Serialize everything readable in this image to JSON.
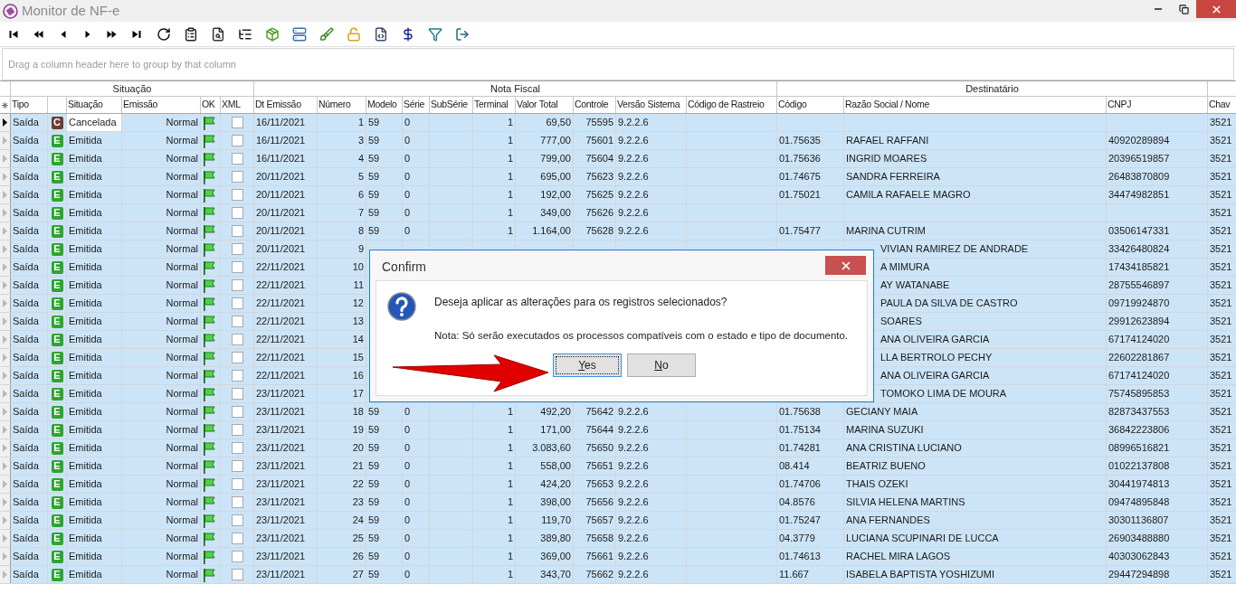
{
  "window": {
    "title": "Monitor de NF-e"
  },
  "group_panel": {
    "placeholder": "Drag a column header here to group by that column"
  },
  "column_groups": [
    {
      "label": "Situação"
    },
    {
      "label": "Nota Fiscal"
    },
    {
      "label": "Destinatário"
    }
  ],
  "columns": [
    "Tipo",
    "Situação",
    "Emissão",
    "OK",
    "XML",
    "Dt Emissão",
    "Número",
    "Modelo",
    "Série",
    "SubSérie",
    "Terminal",
    "Valor Total",
    "Controle",
    "Versão Sistema",
    "Código de Rastreio",
    "Código",
    "Razão Social / Nome",
    "CNPJ",
    "Chav"
  ],
  "rows": [
    {
      "selected": true,
      "current": true,
      "tipo": "Saída",
      "status_icon": "C",
      "color": "#6e3b33",
      "situacao": "Cancelada",
      "emissao": "Normal",
      "xml": false,
      "dt_emissao": "16/11/2021",
      "numero": "1",
      "modelo": "59",
      "serie": "0",
      "terminal": "1",
      "valor_total": "69,50",
      "controle": "75595",
      "versao": "9.2.2.6",
      "chave": "3521"
    },
    {
      "selected": true,
      "current": false,
      "tipo": "Saída",
      "status_icon": "E",
      "color": "#2ea52e",
      "situacao": "Emitida",
      "emissao": "Normal",
      "xml": false,
      "dt_emissao": "16/11/2021",
      "numero": "3",
      "modelo": "59",
      "serie": "0",
      "terminal": "1",
      "valor_total": "777,00",
      "controle": "75601",
      "versao": "9.2.2.6",
      "codigo": "01.75635",
      "razao_social": "RAFAEL RAFFANI",
      "cnpj": "40920289894",
      "chave": "3521"
    },
    {
      "selected": true,
      "current": false,
      "tipo": "Saída",
      "status_icon": "E",
      "color": "#2ea52e",
      "situacao": "Emitida",
      "emissao": "Normal",
      "xml": false,
      "dt_emissao": "16/11/2021",
      "numero": "4",
      "modelo": "59",
      "serie": "0",
      "terminal": "1",
      "valor_total": "799,00",
      "controle": "75604",
      "versao": "9.2.2.6",
      "codigo": "01.75636",
      "razao_social": "INGRID MOARES",
      "cnpj": "20396519857",
      "chave": "3521"
    },
    {
      "selected": true,
      "current": false,
      "tipo": "Saída",
      "status_icon": "E",
      "color": "#2ea52e",
      "situacao": "Emitida",
      "emissao": "Normal",
      "xml": false,
      "dt_emissao": "20/11/2021",
      "numero": "5",
      "modelo": "59",
      "serie": "0",
      "terminal": "1",
      "valor_total": "695,00",
      "controle": "75623",
      "versao": "9.2.2.6",
      "codigo": "01.74675",
      "razao_social": "SANDRA FERREIRA",
      "cnpj": "26483870809",
      "chave": "3521"
    },
    {
      "selected": true,
      "current": false,
      "tipo": "Saída",
      "status_icon": "E",
      "color": "#2ea52e",
      "situacao": "Emitida",
      "emissao": "Normal",
      "xml": false,
      "dt_emissao": "20/11/2021",
      "numero": "6",
      "modelo": "59",
      "serie": "0",
      "terminal": "1",
      "valor_total": "192,00",
      "controle": "75625",
      "versao": "9.2.2.6",
      "codigo": "01.75021",
      "razao_social": "CAMILA RAFAELE MAGRO",
      "cnpj": "34474982851",
      "chave": "3521"
    },
    {
      "selected": true,
      "current": false,
      "tipo": "Saída",
      "status_icon": "E",
      "color": "#2ea52e",
      "situacao": "Emitida",
      "emissao": "Normal",
      "xml": false,
      "dt_emissao": "20/11/2021",
      "numero": "7",
      "modelo": "59",
      "serie": "0",
      "terminal": "1",
      "valor_total": "349,00",
      "controle": "75626",
      "versao": "9.2.2.6",
      "chave": "3521"
    },
    {
      "selected": true,
      "current": false,
      "tipo": "Saída",
      "status_icon": "E",
      "color": "#2ea52e",
      "situacao": "Emitida",
      "emissao": "Normal",
      "xml": false,
      "dt_emissao": "20/11/2021",
      "numero": "8",
      "modelo": "59",
      "serie": "0",
      "terminal": "1",
      "valor_total": "1.164,00",
      "controle": "75628",
      "versao": "9.2.2.6",
      "codigo": "01.75477",
      "razao_social": "MARINA CUTRIM",
      "cnpj": "03506147331",
      "chave": "3521"
    },
    {
      "selected": true,
      "current": false,
      "tipo": "Saída",
      "status_icon": "E",
      "color": "#2ea52e",
      "situacao": "Emitida",
      "emissao": "Normal",
      "xml": false,
      "dt_emissao": "20/11/2021",
      "numero": "9",
      "razao_social": "VIVIAN RAMIREZ DE ANDRADE",
      "cnpj": "33426480824",
      "chave": "3521"
    },
    {
      "selected": true,
      "current": false,
      "tipo": "Saída",
      "status_icon": "E",
      "color": "#2ea52e",
      "situacao": "Emitida",
      "emissao": "Normal",
      "xml": false,
      "dt_emissao": "22/11/2021",
      "numero": "10",
      "razao_social": "A MIMURA",
      "cnpj": "17434185821",
      "chave": "3521"
    },
    {
      "selected": true,
      "current": false,
      "tipo": "Saída",
      "status_icon": "E",
      "color": "#2ea52e",
      "situacao": "Emitida",
      "emissao": "Normal",
      "xml": false,
      "dt_emissao": "22/11/2021",
      "numero": "11",
      "razao_social": "AY WATANABE",
      "cnpj": "28755546897",
      "chave": "3521"
    },
    {
      "selected": true,
      "current": false,
      "tipo": "Saída",
      "status_icon": "E",
      "color": "#2ea52e",
      "situacao": "Emitida",
      "emissao": "Normal",
      "xml": false,
      "dt_emissao": "22/11/2021",
      "numero": "12",
      "razao_social": "PAULA DA SILVA DE CASTRO",
      "cnpj": "09719924870",
      "chave": "3521"
    },
    {
      "selected": true,
      "current": false,
      "tipo": "Saída",
      "status_icon": "E",
      "color": "#2ea52e",
      "situacao": "Emitida",
      "emissao": "Normal",
      "xml": false,
      "dt_emissao": "22/11/2021",
      "numero": "13",
      "razao_social": "SOARES",
      "cnpj": "29912623894",
      "chave": "3521"
    },
    {
      "selected": true,
      "current": false,
      "tipo": "Saída",
      "status_icon": "E",
      "color": "#2ea52e",
      "situacao": "Emitida",
      "emissao": "Normal",
      "xml": false,
      "dt_emissao": "22/11/2021",
      "numero": "14",
      "razao_social": "ANA OLIVEIRA GARCIA",
      "cnpj": "67174124020",
      "chave": "3521"
    },
    {
      "selected": true,
      "current": false,
      "tipo": "Saída",
      "status_icon": "E",
      "color": "#2ea52e",
      "situacao": "Emitida",
      "emissao": "Normal",
      "xml": false,
      "dt_emissao": "22/11/2021",
      "numero": "15",
      "razao_social": "LLA BERTROLO PECHY",
      "cnpj": "22602281867",
      "chave": "3521"
    },
    {
      "selected": true,
      "current": false,
      "tipo": "Saída",
      "status_icon": "E",
      "color": "#2ea52e",
      "situacao": "Emitida",
      "emissao": "Normal",
      "xml": false,
      "dt_emissao": "22/11/2021",
      "numero": "16",
      "razao_social": "ANA OLIVEIRA GARCIA",
      "cnpj": "67174124020",
      "chave": "3521"
    },
    {
      "selected": true,
      "current": false,
      "tipo": "Saída",
      "status_icon": "E",
      "color": "#2ea52e",
      "situacao": "Emitida",
      "emissao": "Normal",
      "xml": false,
      "dt_emissao": "23/11/2021",
      "numero": "17",
      "razao_social": "TOMOKO LIMA DE MOURA",
      "cnpj": "75745895853",
      "chave": "3521"
    },
    {
      "selected": true,
      "current": false,
      "tipo": "Saída",
      "status_icon": "E",
      "color": "#2ea52e",
      "situacao": "Emitida",
      "emissao": "Normal",
      "xml": false,
      "dt_emissao": "23/11/2021",
      "numero": "18",
      "modelo": "59",
      "serie": "0",
      "terminal": "1",
      "valor_total": "492,20",
      "controle": "75642",
      "versao": "9.2.2.6",
      "codigo": "01.75638",
      "razao_social": "GECIANY MAIA",
      "cnpj": "82873437553",
      "chave": "3521"
    },
    {
      "selected": true,
      "current": false,
      "tipo": "Saída",
      "status_icon": "E",
      "color": "#2ea52e",
      "situacao": "Emitida",
      "emissao": "Normal",
      "xml": false,
      "dt_emissao": "23/11/2021",
      "numero": "19",
      "modelo": "59",
      "serie": "0",
      "terminal": "1",
      "valor_total": "171,00",
      "controle": "75644",
      "versao": "9.2.2.6",
      "codigo": "01.75134",
      "razao_social": "MARINA SUZUKI",
      "cnpj": "36842223806",
      "chave": "3521"
    },
    {
      "selected": true,
      "current": false,
      "tipo": "Saída",
      "status_icon": "E",
      "color": "#2ea52e",
      "situacao": "Emitida",
      "emissao": "Normal",
      "xml": false,
      "dt_emissao": "23/11/2021",
      "numero": "20",
      "modelo": "59",
      "serie": "0",
      "terminal": "1",
      "valor_total": "3.083,60",
      "controle": "75650",
      "versao": "9.2.2.6",
      "codigo": "01.74281",
      "razao_social": "ANA CRISTINA LUCIANO",
      "cnpj": "08996516821",
      "chave": "3521"
    },
    {
      "selected": true,
      "current": false,
      "tipo": "Saída",
      "status_icon": "E",
      "color": "#2ea52e",
      "situacao": "Emitida",
      "emissao": "Normal",
      "xml": false,
      "dt_emissao": "23/11/2021",
      "numero": "21",
      "modelo": "59",
      "serie": "0",
      "terminal": "1",
      "valor_total": "558,00",
      "controle": "75651",
      "versao": "9.2.2.6",
      "codigo": "08.414",
      "razao_social": "BEATRIZ BUENO",
      "cnpj": "01022137808",
      "chave": "3521"
    },
    {
      "selected": true,
      "current": false,
      "tipo": "Saída",
      "status_icon": "E",
      "color": "#2ea52e",
      "situacao": "Emitida",
      "emissao": "Normal",
      "xml": false,
      "dt_emissao": "23/11/2021",
      "numero": "22",
      "modelo": "59",
      "serie": "0",
      "terminal": "1",
      "valor_total": "424,20",
      "controle": "75653",
      "versao": "9.2.2.6",
      "codigo": "01.74706",
      "razao_social": "THAIS OZEKI",
      "cnpj": "30441974813",
      "chave": "3521"
    },
    {
      "selected": true,
      "current": false,
      "tipo": "Saída",
      "status_icon": "E",
      "color": "#2ea52e",
      "situacao": "Emitida",
      "emissao": "Normal",
      "xml": false,
      "dt_emissao": "23/11/2021",
      "numero": "23",
      "modelo": "59",
      "serie": "0",
      "terminal": "1",
      "valor_total": "398,00",
      "controle": "75656",
      "versao": "9.2.2.6",
      "codigo": "04.8576",
      "razao_social": "SILVIA HELENA MARTINS",
      "cnpj": "09474895848",
      "chave": "3521"
    },
    {
      "selected": true,
      "current": false,
      "tipo": "Saída",
      "status_icon": "E",
      "color": "#2ea52e",
      "situacao": "Emitida",
      "emissao": "Normal",
      "xml": false,
      "dt_emissao": "23/11/2021",
      "numero": "24",
      "modelo": "59",
      "serie": "0",
      "terminal": "1",
      "valor_total": "119,70",
      "controle": "75657",
      "versao": "9.2.2.6",
      "codigo": "01.75247",
      "razao_social": "ANA FERNANDES",
      "cnpj": "30301136807",
      "chave": "3521"
    },
    {
      "selected": true,
      "current": false,
      "tipo": "Saída",
      "status_icon": "E",
      "color": "#2ea52e",
      "situacao": "Emitida",
      "emissao": "Normal",
      "xml": false,
      "dt_emissao": "23/11/2021",
      "numero": "25",
      "modelo": "59",
      "serie": "0",
      "terminal": "1",
      "valor_total": "389,80",
      "controle": "75658",
      "versao": "9.2.2.6",
      "codigo": "04.3779",
      "razao_social": "LUCIANA SCUPINARI DE LUCCA",
      "cnpj": "26903488880",
      "chave": "3521"
    },
    {
      "selected": true,
      "current": false,
      "tipo": "Saída",
      "status_icon": "E",
      "color": "#2ea52e",
      "situacao": "Emitida",
      "emissao": "Normal",
      "xml": false,
      "dt_emissao": "23/11/2021",
      "numero": "26",
      "modelo": "59",
      "serie": "0",
      "terminal": "1",
      "valor_total": "369,00",
      "controle": "75661",
      "versao": "9.2.2.6",
      "codigo": "01.74613",
      "razao_social": "RACHEL MIRA LAGOS",
      "cnpj": "40303062843",
      "chave": "3521"
    },
    {
      "selected": true,
      "current": false,
      "tipo": "Saída",
      "status_icon": "E",
      "color": "#2ea52e",
      "situacao": "Emitida",
      "emissao": "Normal",
      "xml": false,
      "dt_emissao": "23/11/2021",
      "numero": "27",
      "modelo": "59",
      "serie": "0",
      "terminal": "1",
      "valor_total": "343,70",
      "controle": "75662",
      "versao": "9.2.2.6",
      "codigo": "11.667",
      "razao_social": "ISABELA BAPTISTA YOSHIZUMI",
      "cnpj": "29447294898",
      "chave": "3521"
    }
  ],
  "dialog": {
    "title": "Confirm",
    "message": "Deseja aplicar as alterações para os registros selecionados?",
    "note": "Nota: Só serão executados os processos compatíveis com o estado e tipo de documento.",
    "buttons": [
      {
        "label": "Yes",
        "focused": true
      },
      {
        "label": "No",
        "focused": false
      }
    ]
  }
}
